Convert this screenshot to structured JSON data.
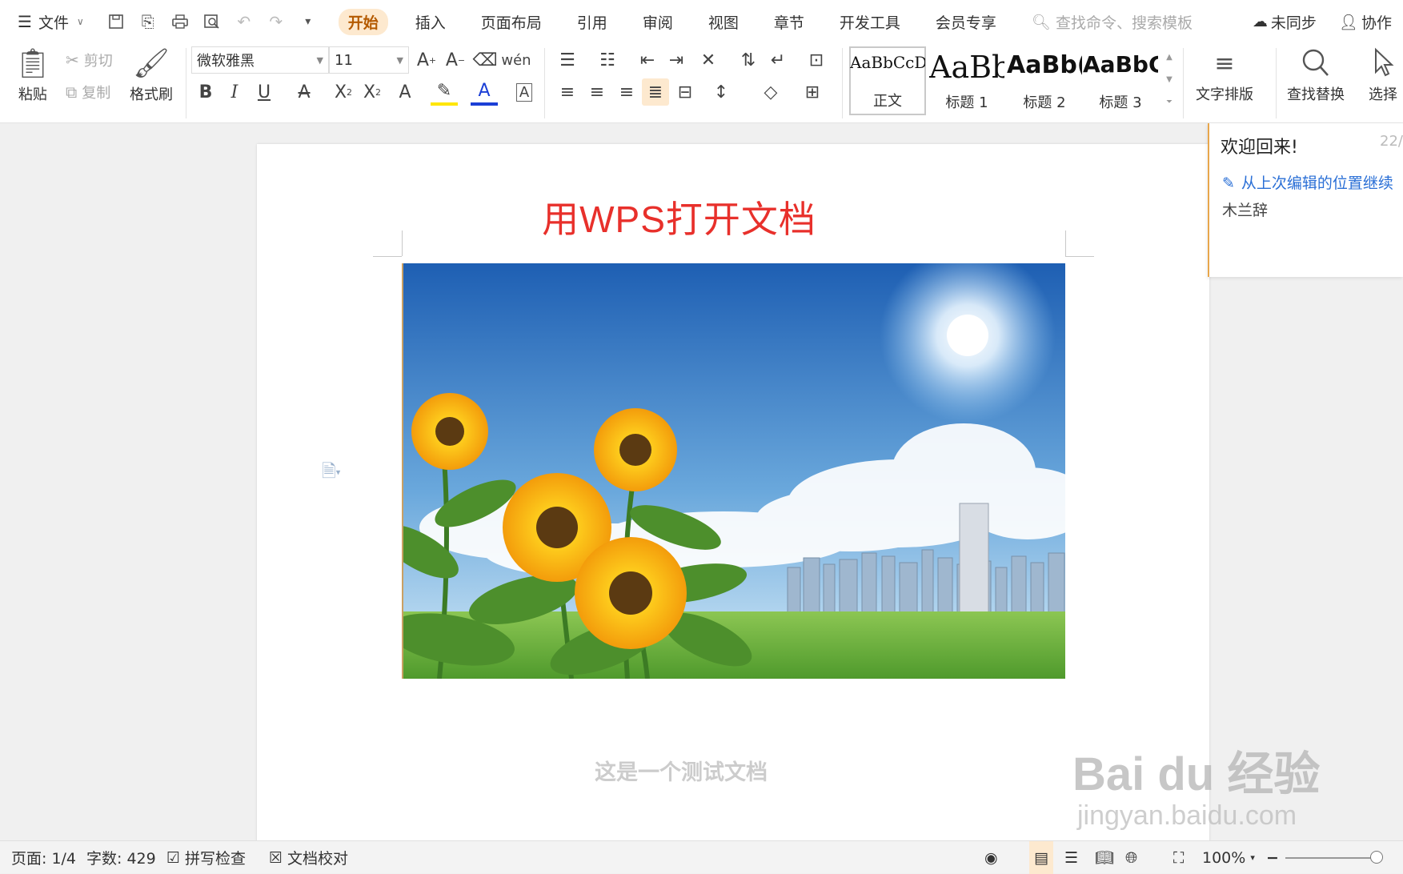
{
  "menubar": {
    "file_label": "文件",
    "tabs": [
      "开始",
      "插入",
      "页面布局",
      "引用",
      "审阅",
      "视图",
      "章节",
      "开发工具",
      "会员专享"
    ],
    "active_tab": "开始",
    "search_placeholder": "查找命令、搜索模板",
    "sync_label": "未同步",
    "collab_label": "协作"
  },
  "ribbon": {
    "paste": "粘贴",
    "cut": "剪切",
    "copy": "复制",
    "format_painter": "格式刷",
    "font_name": "微软雅黑",
    "font_size": "11",
    "styles": [
      {
        "preview": "AaBbCcDd",
        "label": "正文"
      },
      {
        "preview": "AaBb",
        "label": "标题 1"
      },
      {
        "preview": "AaBb(",
        "label": "标题 2"
      },
      {
        "preview": "AaBbC",
        "label": "标题 3"
      }
    ],
    "text_layout": "文字排版",
    "find_replace": "查找替换",
    "select": "选择"
  },
  "document": {
    "title": "用WPS打开文档",
    "body_text": "这是一个测试文档"
  },
  "welcome_panel": {
    "heading": "欢迎回来!",
    "date": "22/",
    "continue_link": "从上次编辑的位置继续",
    "file_name": "木兰辞"
  },
  "statusbar": {
    "page": "页面: 1/4",
    "word_count": "字数: 429",
    "spell_check": "拼写检查",
    "proofread": "文档校对",
    "zoom": "100%"
  },
  "watermark": {
    "brand": "Bai du 经验",
    "url": "jingyan.baidu.com"
  },
  "colors": {
    "title_red": "#e8302b",
    "active_tab_bg": "#fde9cf",
    "link_blue": "#2a6fd6",
    "panel_accent": "#e8a64b"
  }
}
